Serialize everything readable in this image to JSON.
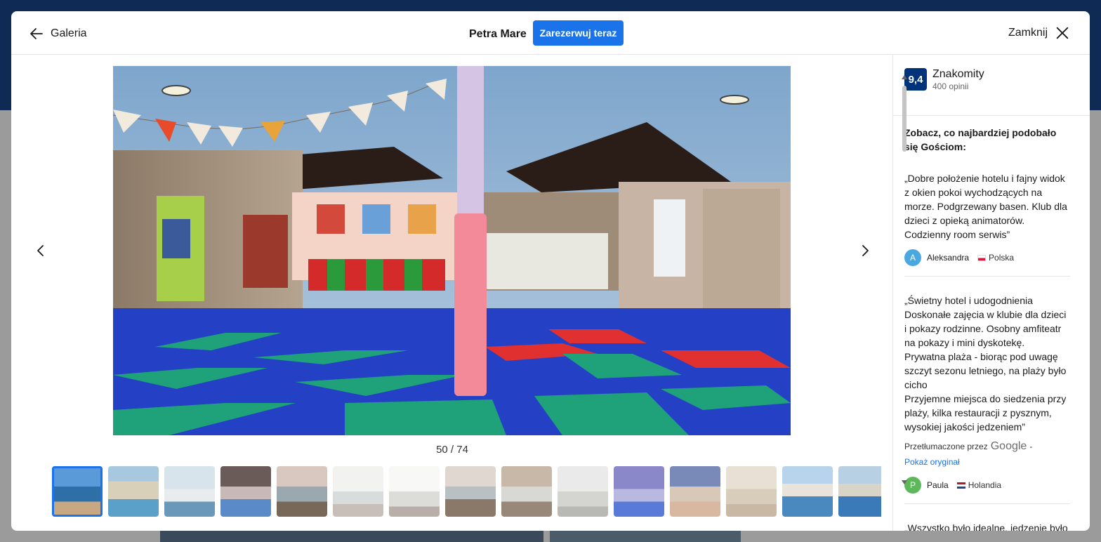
{
  "header": {
    "back_label": "Galeria",
    "hotel_name": "Petra Mare",
    "reserve_label": "Zarezerwuj teraz",
    "close_label": "Zamknij"
  },
  "gallery": {
    "counter": "50 / 74",
    "thumbnail_count": 15
  },
  "rating": {
    "score": "9,4",
    "label": "Znakomity",
    "count": "400 opinii"
  },
  "reviews": {
    "title": "Zobacz, co najbardziej podobało się Gościom:",
    "items": [
      {
        "text": "„Dobre położenie hotelu i fajny widok z okien pokoi wychodzących na morze. Podgrzewany basen. Klub dla dzieci z opieką animatorów. Codzienny room serwis”",
        "name": "Aleksandra",
        "initial": "A",
        "country": "Polska"
      },
      {
        "text": "„Świetny hotel i udogodnienia\nDoskonałe zajęcia w klubie dla dzieci i pokazy rodzinne. Osobny amfiteatr na pokazy i mini dyskotekę.\nPrywatna plaża - biorąc pod uwagę szczyt sezonu letniego, na plaży było cicho\nPrzyjemne miejsca do siedzenia przy plaży, kilka restauracji z pysznym, wysokiej jakości jedzeniem”",
        "translated_prefix": "Przetłumaczone przez",
        "translated_brand": "Google",
        "translated_suffix": "-",
        "show_original": "Pokaż oryginał",
        "name": "Paula",
        "initial": "P",
        "country": "Holandia"
      },
      {
        "text": "„Wszystko było idealne, jedzenie było"
      }
    ]
  },
  "colors": {
    "accent": "#1a73e8",
    "rating_badge": "#00337a",
    "avatar_a": "#4aa8e0",
    "avatar_p": "#5db85c"
  }
}
